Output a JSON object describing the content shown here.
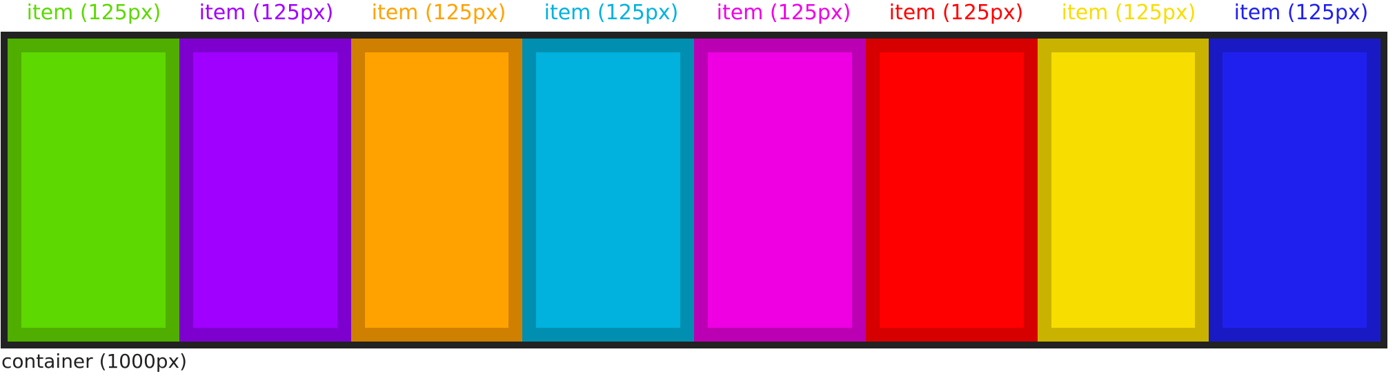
{
  "items": [
    {
      "label": "item (125px)",
      "fill": "#5dd800",
      "edge": "#4fae00",
      "text_color": "#5dd800"
    },
    {
      "label": "item (125px)",
      "fill": "#a000ff",
      "edge": "#7e00cf",
      "text_color": "#a000ff"
    },
    {
      "label": "item (125px)",
      "fill": "#ffa200",
      "edge": "#cf8000",
      "text_color": "#ffa200"
    },
    {
      "label": "item (125px)",
      "fill": "#00b2dd",
      "edge": "#008fb0",
      "text_color": "#00b2dd"
    },
    {
      "label": "item (125px)",
      "fill": "#ee00e3",
      "edge": "#bb00b3",
      "text_color": "#ee00e3"
    },
    {
      "label": "item (125px)",
      "fill": "#ff0000",
      "edge": "#d60000",
      "text_color": "#ff0000"
    },
    {
      "label": "item (125px)",
      "fill": "#f8dd00",
      "edge": "#c9b300",
      "text_color": "#f8dd00"
    },
    {
      "label": "item (125px)",
      "fill": "#2020ee",
      "edge": "#1a1ac4",
      "text_color": "#2020ee"
    }
  ],
  "container": {
    "label": "container (1000px)",
    "border_color": "#222222"
  }
}
